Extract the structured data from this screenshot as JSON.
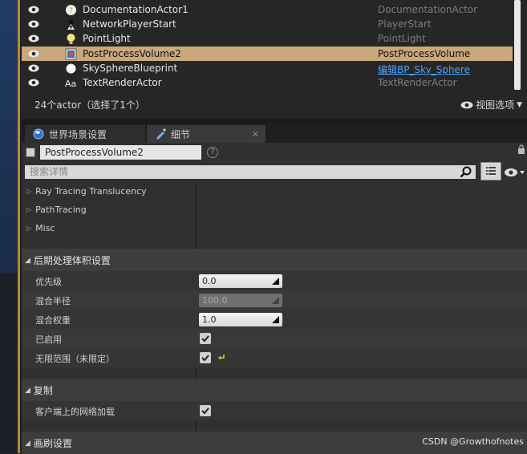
{
  "outliner": {
    "rows": [
      {
        "name": "DocumentationActor1",
        "type": "DocumentationActor",
        "icon": "documentation-actor-icon",
        "selected": false,
        "link": false
      },
      {
        "name": "NetworkPlayerStart",
        "type": "PlayerStart",
        "icon": "player-start-icon",
        "selected": false,
        "link": false
      },
      {
        "name": "PointLight",
        "type": "PointLight",
        "icon": "point-light-icon",
        "selected": false,
        "link": false
      },
      {
        "name": "PostProcessVolume2",
        "type": "PostProcessVolume",
        "icon": "post-process-volume-icon",
        "selected": true,
        "link": false
      },
      {
        "name": "SkySphereBlueprint",
        "type": "编辑BP_Sky_Sphere",
        "icon": "sky-sphere-icon",
        "selected": false,
        "link": true
      },
      {
        "name": "TextRenderActor",
        "type": "TextRenderActor",
        "icon": "text-render-icon",
        "selected": false,
        "link": false
      }
    ],
    "count_label": "24个actor（选择了1个）",
    "view_options_label": "视图选项"
  },
  "tabs": [
    {
      "label": "世界场景设置",
      "icon": "globe-icon"
    },
    {
      "label": "细节",
      "icon": "details-icon"
    }
  ],
  "details": {
    "object_name": "PostProcessVolume2",
    "search_placeholder": "搜索详情",
    "subsections": [
      "Ray Tracing Translucency",
      "PathTracing",
      "Misc"
    ],
    "category_post_process": "后期处理体积设置",
    "props": {
      "priority_label": "优先级",
      "priority_value": "0.0",
      "blend_radius_label": "混合半径",
      "blend_radius_value": "100.0",
      "blend_weight_label": "混合权重",
      "blend_weight_value": "1.0",
      "enabled_label": "已启用",
      "unbound_label": "无限范围（未限定）"
    },
    "category_replication": "复制",
    "net_load_label": "客户端上的网络加载",
    "category_brush": "画刷设置"
  },
  "watermark": "CSDN @Growthofnotes",
  "colors": {
    "selected_row": "#c9a87c",
    "link": "#4aa3ff",
    "gold_border": "#b8892e"
  }
}
